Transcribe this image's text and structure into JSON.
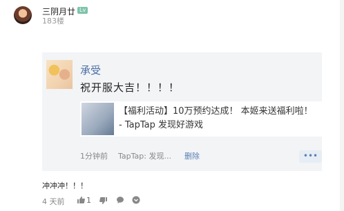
{
  "user": {
    "name": "三阴月廿",
    "level": "Lv",
    "floor": "183楼"
  },
  "quote": {
    "author": "承受",
    "text": "祝开服大吉！！！！",
    "link_title": "【福利活动】10万预约达成！ 本姬来送福利啦！ - TapTap 发现好游戏",
    "time": "1分钟前",
    "source": "TapTap: 发现...",
    "delete_label": "删除",
    "more_label": "•••"
  },
  "reply": {
    "text": "冲冲冲！！！",
    "time": "4 天前",
    "like_count": "1"
  },
  "icons": {
    "like": "thumbs-up-icon",
    "dislike": "thumbs-down-icon",
    "comment": "comment-icon",
    "more": "chevron-down-circle-icon"
  },
  "colors": {
    "link": "#4a6fa5",
    "level_badge": "#7cc3a9",
    "quote_bg": "#f3f4f6"
  }
}
